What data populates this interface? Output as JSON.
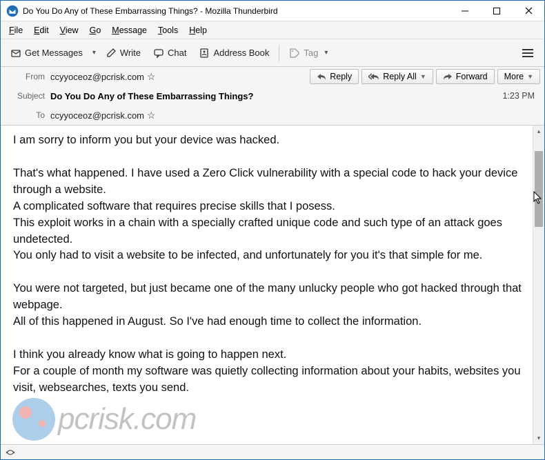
{
  "window": {
    "title": "Do You Do Any of These Embarrassing Things? - Mozilla Thunderbird"
  },
  "menubar": {
    "file": "File",
    "edit": "Edit",
    "view": "View",
    "go": "Go",
    "message": "Message",
    "tools": "Tools",
    "help": "Help"
  },
  "toolbar": {
    "get_messages": "Get Messages",
    "write": "Write",
    "chat": "Chat",
    "address_book": "Address Book",
    "tag": "Tag"
  },
  "header": {
    "from_label": "From",
    "from_value": "ccyyoceoz@pcrisk.com",
    "subject_label": "Subject",
    "subject_value": "Do You Do Any of These Embarrassing Things?",
    "to_label": "To",
    "to_value": "ccyyoceoz@pcrisk.com",
    "time": "1:23 PM",
    "reply": "Reply",
    "reply_all": "Reply All",
    "forward": "Forward",
    "more": "More"
  },
  "body": {
    "p1": "I am sorry to inform you but your device was hacked.",
    "p2": "That's what happened. I have used a Zero Click vulnerability with a special code to hack your device through a website.",
    "p3": "A complicated software that requires precise skills that I posess.",
    "p4": "This exploit works in a chain with a specially crafted unique code and such type of an attack goes undetected.",
    "p5": "You only had to visit a website to be infected, and unfortunately for you it's that simple for me.",
    "p6": "You were not targeted, but just became one of the many unlucky people who got hacked through that webpage.",
    "p7": "All of this happened in August. So I've had enough time to collect the information.",
    "p8": "I think you already know what is going to happen next.",
    "p9": "For a couple of month my software was quietly collecting information about your habits, websites you visit, websearches, texts you send."
  },
  "watermark": {
    "text": "pcrisk.com"
  }
}
